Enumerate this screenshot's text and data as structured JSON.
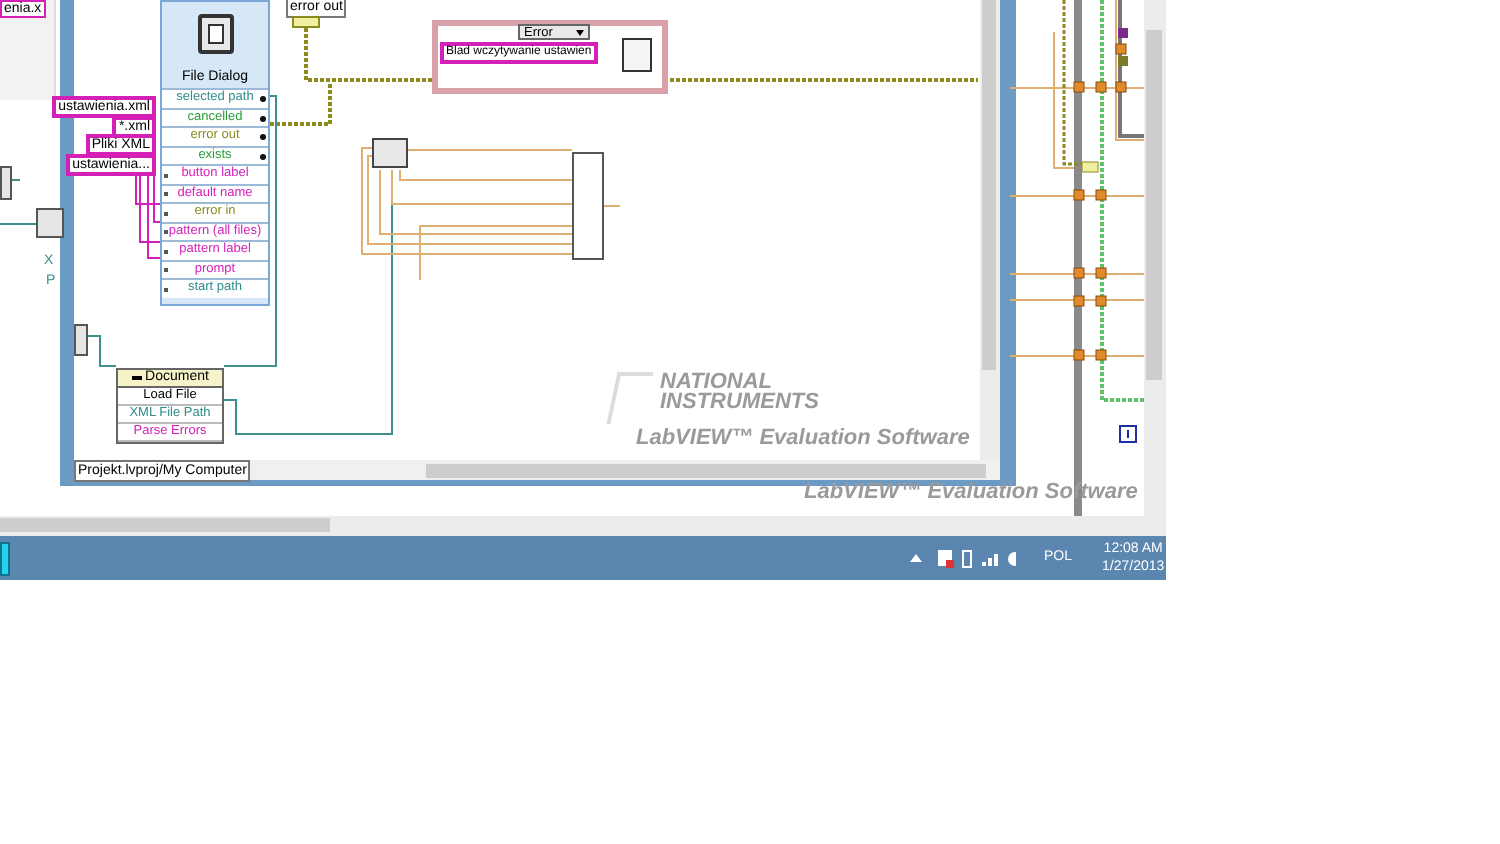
{
  "background_window": {
    "cut_label": "enia.x",
    "cut_fragments": [
      "X",
      "P"
    ]
  },
  "file_dialog": {
    "title": "File Dialog",
    "terminals": [
      {
        "label": "selected path",
        "kind": "path",
        "output": true
      },
      {
        "label": "cancelled",
        "kind": "boolean",
        "output": true
      },
      {
        "label": "error out",
        "kind": "error",
        "output": true
      },
      {
        "label": "exists",
        "kind": "boolean",
        "output": true
      },
      {
        "label": "button label",
        "kind": "string",
        "output": false
      },
      {
        "label": "default name",
        "kind": "string",
        "output": false
      },
      {
        "label": "error in",
        "kind": "error",
        "output": false
      },
      {
        "label": "pattern (all files)",
        "kind": "string",
        "output": false
      },
      {
        "label": "pattern label",
        "kind": "string",
        "output": false
      },
      {
        "label": "prompt",
        "kind": "string",
        "output": false
      },
      {
        "label": "start path",
        "kind": "path",
        "output": false
      }
    ]
  },
  "constants": [
    "ustawienia.xml",
    "*.xml",
    "Pliki XML",
    "ustawienia..."
  ],
  "error_out_indicator": {
    "label": "error out"
  },
  "case_structure": {
    "selector": "Error",
    "message": "Blad wczytywanie ustawien"
  },
  "document_node": {
    "class": "Document",
    "rows": [
      {
        "label": "Load File",
        "kind": "method"
      },
      {
        "label": "XML File Path",
        "kind": "path"
      },
      {
        "label": "Parse Errors",
        "kind": "string"
      }
    ]
  },
  "vi_window": {
    "status_path": "Projekt.lvproj/My Computer"
  },
  "watermark": {
    "logo_lines": [
      "NATIONAL",
      "INSTRUMENTS"
    ],
    "captions": [
      "LabVIEW™ Evaluation Software",
      "LabVIEW™ Evaluation Software"
    ]
  },
  "taskbar": {
    "language": "POL",
    "time": "12:08 AM",
    "date": "1/27/2013"
  }
}
